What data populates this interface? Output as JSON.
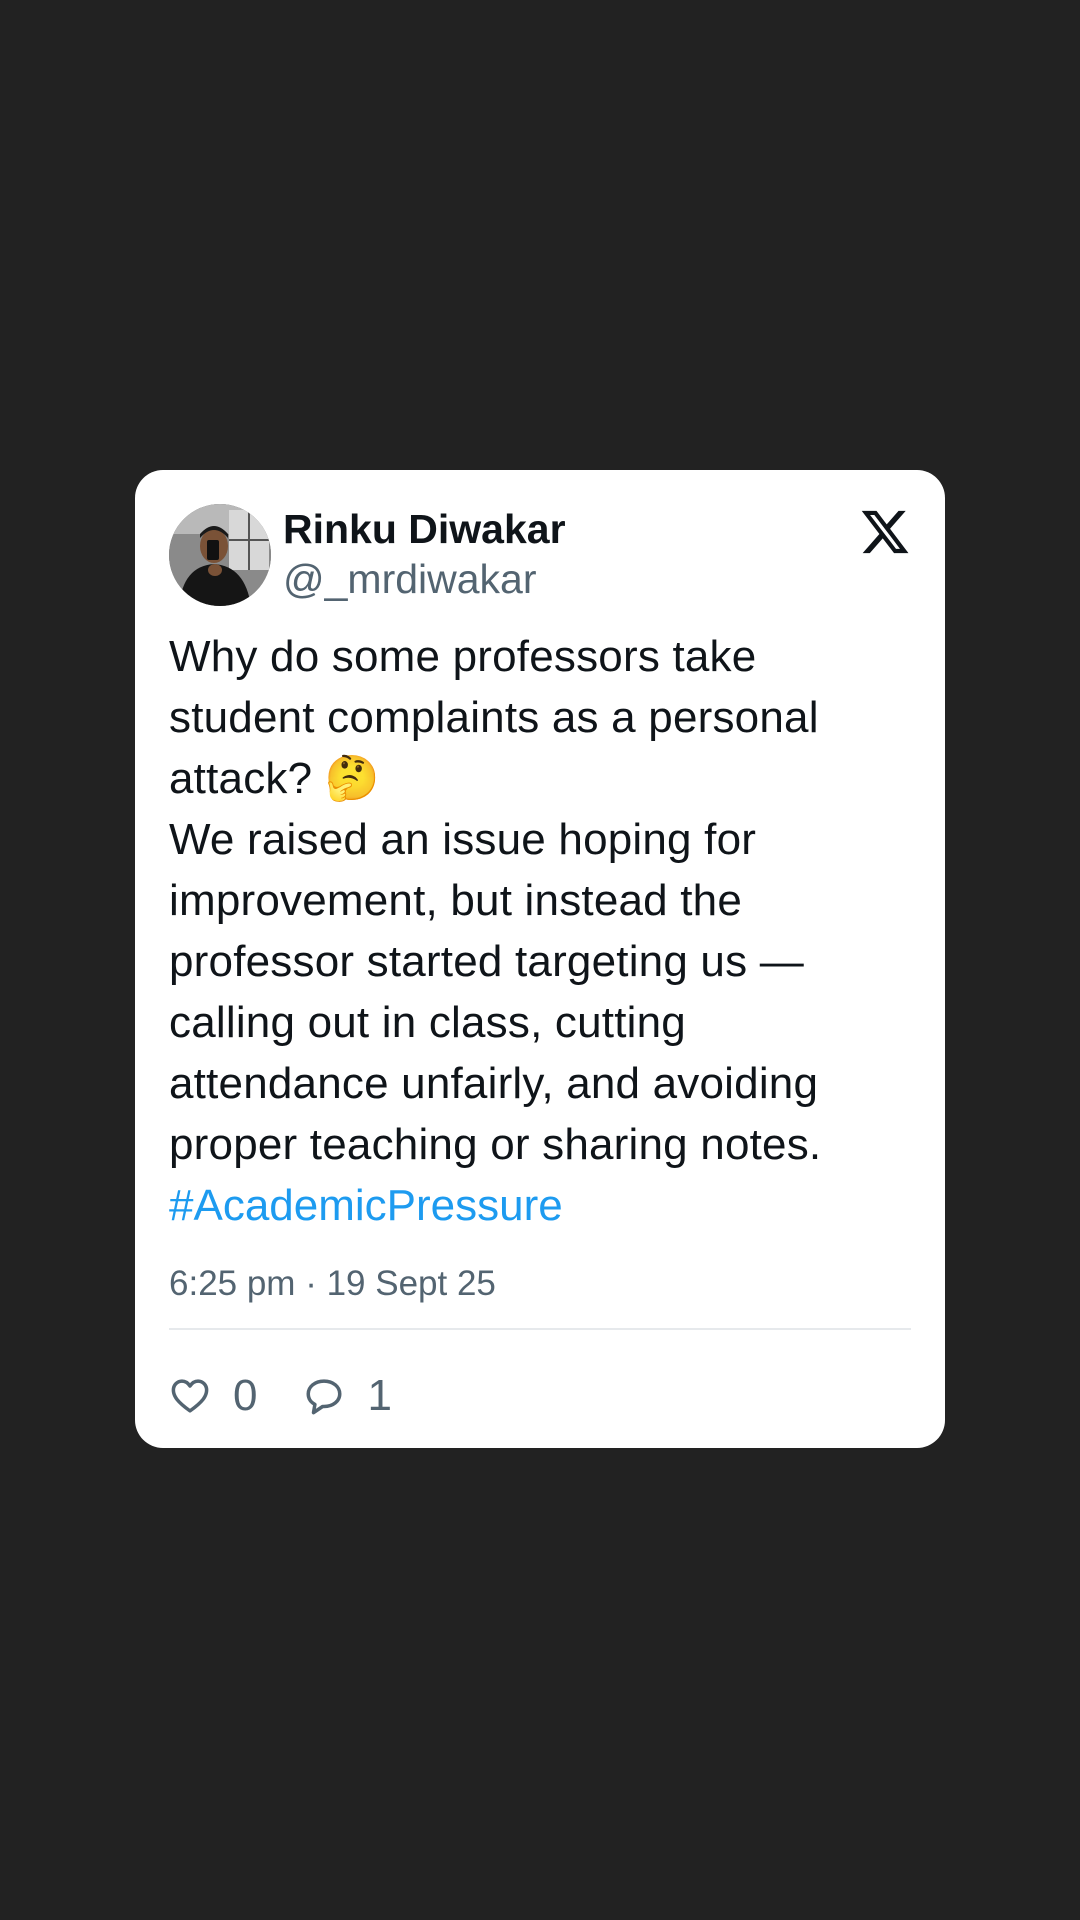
{
  "post": {
    "author": {
      "display_name": "Rinku Diwakar",
      "handle": "@_mrdiwakar"
    },
    "platform_icon": "x-logo-icon",
    "text": "Why do some professors take student complaints as a personal attack? 🤔\nWe raised an issue hoping for improvement, but instead the professor started targeting us — calling out in class, cutting attendance unfairly, and avoiding proper teaching or sharing notes.",
    "hashtag": "#AcademicPressure",
    "timestamp": "6:25 pm · 19 Sept 25",
    "actions": {
      "likes": {
        "icon": "heart-icon",
        "count": "0"
      },
      "replies": {
        "icon": "reply-bubble-icon",
        "count": "1"
      }
    }
  },
  "colors": {
    "background": "#222222",
    "card": "#ffffff",
    "text": "#0f1419",
    "secondary_text": "#536471",
    "link": "#1d9bf0"
  }
}
